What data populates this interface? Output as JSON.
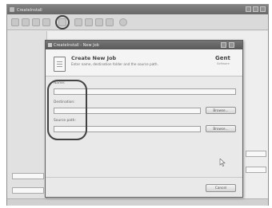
{
  "background": {
    "title": "CreateInstall"
  },
  "dialog": {
    "title": "CreateInstall - New Job",
    "header_title": "Create New Job",
    "header_subtitle": "Enter name, destination folder and the source path.",
    "brand": "Gent",
    "brand_sub": "Software",
    "fields": [
      {
        "label": "Name:"
      },
      {
        "label": "Destination:"
      },
      {
        "label": "Source path:"
      }
    ],
    "browse_label": "Browse...",
    "cancel_label": "Cancel"
  }
}
